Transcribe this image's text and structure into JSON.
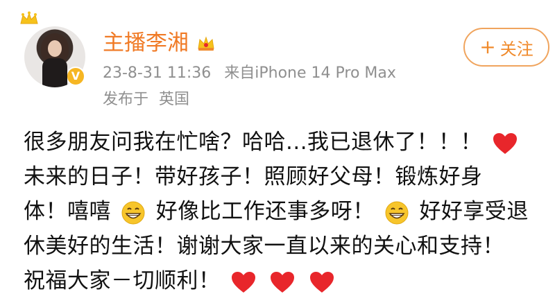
{
  "author": {
    "name": "主播李湘",
    "verified": true,
    "accent_color": "#f07a25"
  },
  "meta": {
    "timestamp": "23-8-31 11:36",
    "source": "来自iPhone 14 Pro Max",
    "location_label": "发布于",
    "location": "英国"
  },
  "follow_button": {
    "label": "关注",
    "icon": "plus-icon"
  },
  "content": {
    "line1_text": "很多朋友问我在忙啥？哈哈...我已退休了！！！",
    "line2_text": "未来的日子！带好孩子！照顾好父母！锻炼好身",
    "line3_part1": "体！嘻嘻",
    "line3_part2": "好像比工作还事多呀！",
    "line3_part3": "好好享受退",
    "line4_text": "休美好的生活！谢谢大家一直以来的关心和支持！",
    "line5_text": "祝福大家－切顺利！"
  },
  "emoji": {
    "heart_color": "#e8262b",
    "grin_color": "#f7c52b"
  }
}
